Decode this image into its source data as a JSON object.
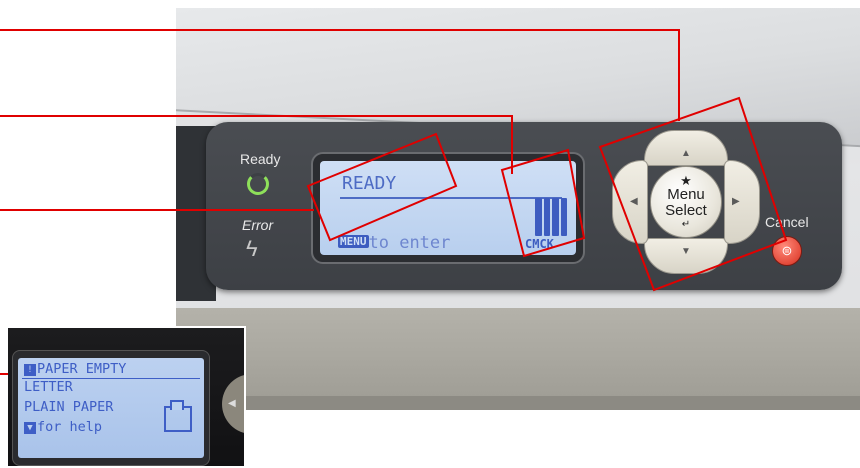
{
  "control_panel": {
    "ready_label": "Ready",
    "error_label": "Error",
    "error_symbol": "ϟ",
    "lcd": {
      "status": "READY",
      "bottom_prefix": "MENU",
      "bottom_text": "to enter",
      "ink_colors": "CMCK"
    },
    "dpad": {
      "star": "★",
      "menu_label": "Menu",
      "select_label": "Select",
      "enter_symbol": "↵",
      "up_arrow": "▲",
      "down_arrow": "▼",
      "left_arrow": "◀",
      "right_arrow": "▶"
    },
    "cancel_label": "Cancel",
    "cancel_symbol": "⊜"
  },
  "inset_lcd": {
    "lines": [
      "PAPER EMPTY",
      "LETTER",
      "PLAIN PAPER",
      "for help"
    ],
    "warning_symbol": "!",
    "help_symbol": "▼"
  },
  "callout_color": "#e00000",
  "accent_colors": {
    "ready_led": "#8ee05a",
    "lcd_text": "#4d6bc4",
    "cancel": "#e44a3a"
  }
}
